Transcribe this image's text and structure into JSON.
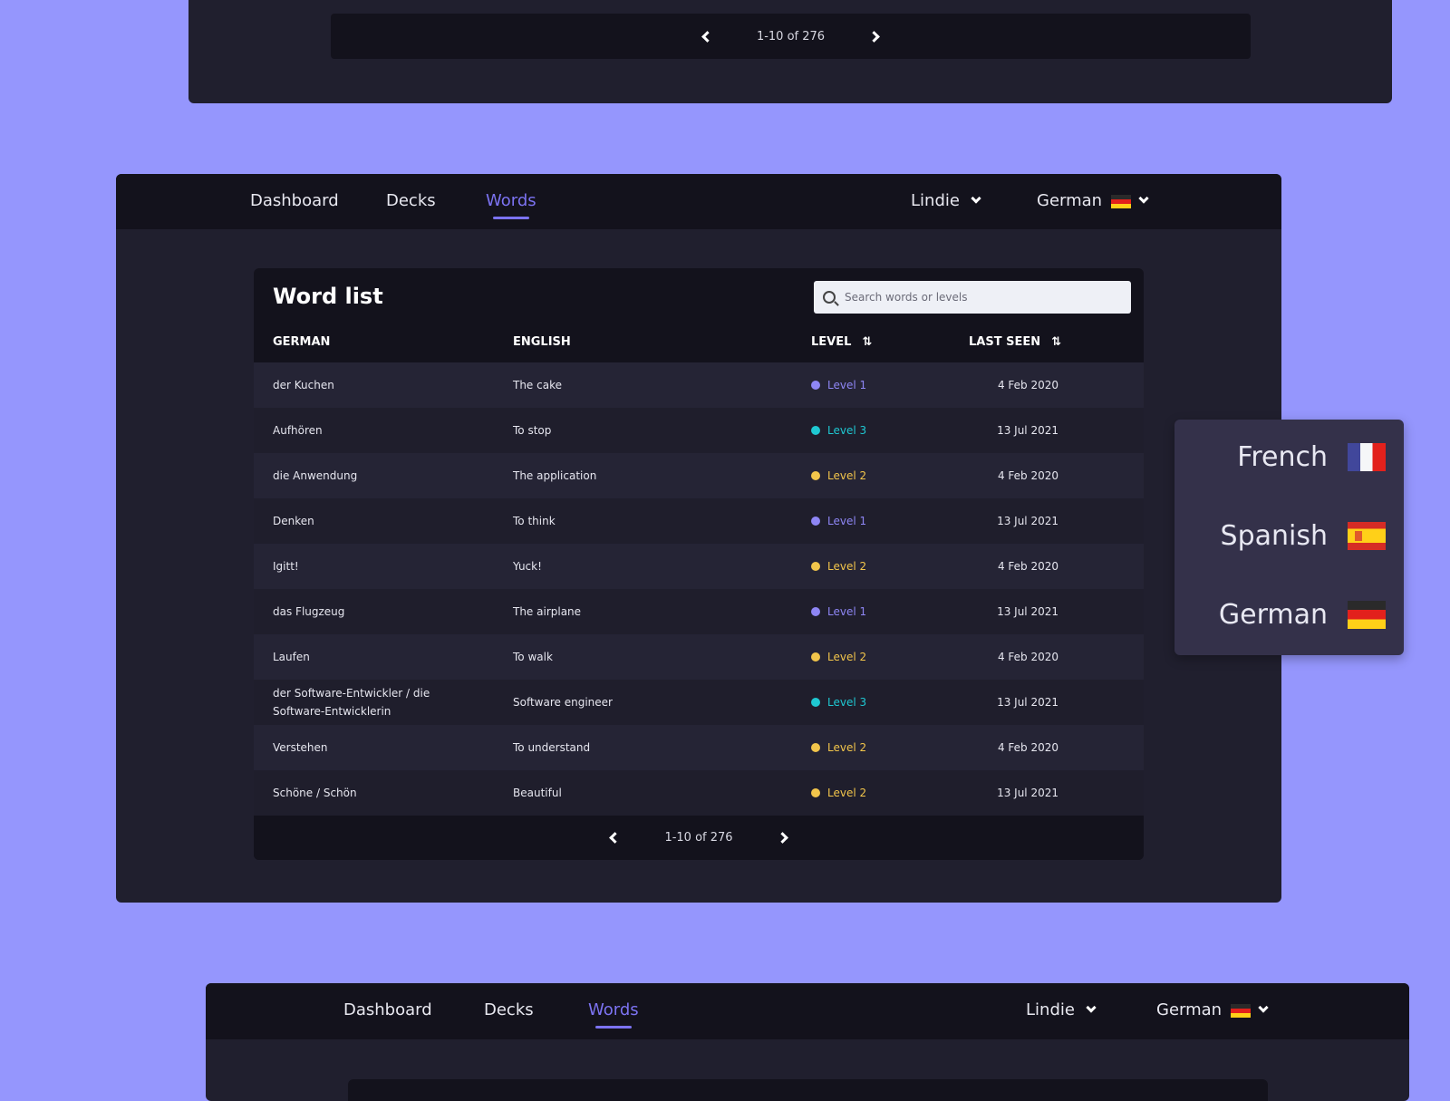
{
  "top_card": {
    "pagination": "1-10 of 276"
  },
  "nav": {
    "items": [
      "Dashboard",
      "Decks",
      "Words"
    ],
    "active": "Words",
    "user": "Lindie",
    "language": "German"
  },
  "word_list": {
    "title": "Word list",
    "search_placeholder": "Search words or levels",
    "columns": [
      "GERMAN",
      "ENGLISH",
      "LEVEL",
      "LAST SEEN"
    ],
    "rows": [
      {
        "german": "der Kuchen",
        "english": "The cake",
        "level": "Level 1",
        "last_seen": "4 Feb 2020"
      },
      {
        "german": "Aufhören",
        "english": "To stop",
        "level": "Level 3",
        "last_seen": "13 Jul 2021"
      },
      {
        "german": "die Anwendung",
        "english": "The application",
        "level": "Level 2",
        "last_seen": "4 Feb 2020"
      },
      {
        "german": "Denken",
        "english": "To think",
        "level": "Level 1",
        "last_seen": "13 Jul 2021"
      },
      {
        "german": "Igitt!",
        "english": "Yuck!",
        "level": "Level 2",
        "last_seen": "4 Feb 2020"
      },
      {
        "german": "das Flugzeug",
        "english": "The airplane",
        "level": "Level 1",
        "last_seen": "13 Jul 2021"
      },
      {
        "german": "Laufen",
        "english": "To walk",
        "level": "Level 2",
        "last_seen": "4 Feb 2020"
      },
      {
        "german": "der Software-Entwickler / die Software-Entwicklerin",
        "english": "Software engineer",
        "level": "Level 3",
        "last_seen": "13 Jul 2021"
      },
      {
        "german": "Verstehen",
        "english": "To understand",
        "level": "Level 2",
        "last_seen": "4 Feb 2020"
      },
      {
        "german": "Schöne / Schön",
        "english": "Beautiful",
        "level": "Level 2",
        "last_seen": "13 Jul 2021"
      }
    ],
    "pagination": "1-10 of 276"
  },
  "level_colors": {
    "Level 1": "#8e86f5",
    "Level 2": "#f2c54b",
    "Level 3": "#1fc8d2"
  },
  "language_menu": [
    "French",
    "Spanish",
    "German"
  ]
}
